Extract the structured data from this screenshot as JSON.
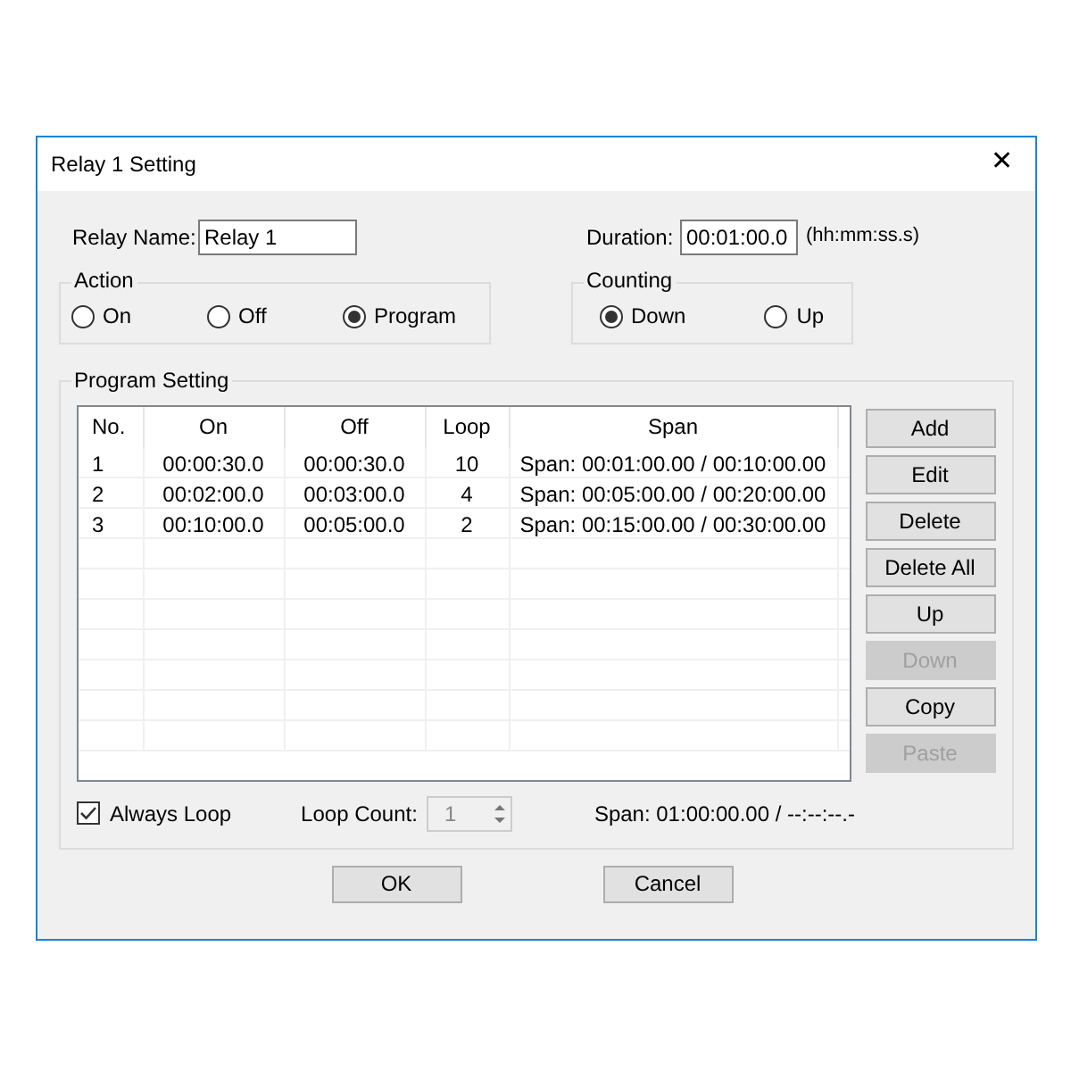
{
  "window": {
    "title": "Relay 1 Setting",
    "close": "✕"
  },
  "relay_name": {
    "label": "Relay Name:",
    "value": "Relay 1"
  },
  "duration": {
    "label": "Duration:",
    "value": "00:01:00.0",
    "hint": "(hh:mm:ss.s)"
  },
  "action": {
    "title": "Action",
    "options": [
      {
        "label": "On",
        "selected": false
      },
      {
        "label": "Off",
        "selected": false
      },
      {
        "label": "Program",
        "selected": true
      }
    ]
  },
  "counting": {
    "title": "Counting",
    "options": [
      {
        "label": "Down",
        "selected": true
      },
      {
        "label": "Up",
        "selected": false
      }
    ]
  },
  "program_setting": {
    "title": "Program Setting",
    "table": {
      "columns": [
        "No.",
        "On",
        "Off",
        "Loop",
        "Span"
      ],
      "rows": [
        [
          "1",
          "00:00:30.0",
          "00:00:30.0",
          "10",
          "Span: 00:01:00.00 / 00:10:00.00"
        ],
        [
          "2",
          "00:02:00.0",
          "00:03:00.0",
          "4",
          "Span: 00:05:00.00 / 00:20:00.00"
        ],
        [
          "3",
          "00:10:00.0",
          "00:05:00.0",
          "2",
          "Span: 00:15:00.00 / 00:30:00.00"
        ]
      ]
    },
    "buttons": [
      {
        "label": "Add",
        "disabled": false
      },
      {
        "label": "Edit",
        "disabled": false
      },
      {
        "label": "Delete",
        "disabled": false
      },
      {
        "label": "Delete All",
        "disabled": false
      },
      {
        "label": "Up",
        "disabled": false
      },
      {
        "label": "Down",
        "disabled": true
      },
      {
        "label": "Copy",
        "disabled": false
      },
      {
        "label": "Paste",
        "disabled": true
      }
    ],
    "always_loop": {
      "label": "Always Loop",
      "checked": true
    },
    "loop_count": {
      "label": "Loop Count:",
      "value": "1",
      "disabled": true
    },
    "span": "Span: 01:00:00.00 / --:--:--.-"
  },
  "footer_buttons": [
    "OK",
    "Cancel"
  ]
}
